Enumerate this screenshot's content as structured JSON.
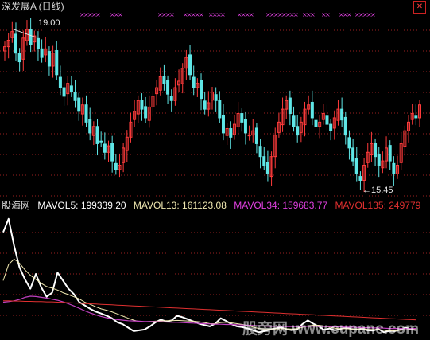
{
  "header": {
    "title": "深发展A (日线)"
  },
  "annotations": {
    "high": "19.00",
    "low": "←15.45"
  },
  "indicator": {
    "name": "股海网",
    "mavol5": "MAVOL5: 199339.20",
    "mavol13": "MAVOL13: 161123.08",
    "mavol34": "MAVOL34: 159683.77",
    "mavol135": "MAVOL135: 249779"
  },
  "watermark": "股旁网 www.cupanc.com",
  "colors": {
    "up": "#ff3b3b",
    "down": "#5fe6e6",
    "marks": "#e040e0",
    "mv5": "#ffffff",
    "mv13": "#f0e8b0",
    "mv34": "#c040c0",
    "mv135": "#e03030",
    "grid": "#9a2020"
  },
  "chart_data": [
    {
      "type": "candlestick",
      "ylim": [
        15.2,
        19.3
      ],
      "markers": {
        "high": 19.0,
        "low": 15.45
      },
      "close": [
        18.55,
        18.7,
        18.9,
        18.4,
        18.2,
        18.75,
        18.95,
        18.6,
        18.8,
        18.5,
        18.3,
        18.5,
        18.1,
        18.4,
        17.9,
        17.6,
        17.4,
        17.7,
        17.5,
        17.3,
        17.05,
        17.2,
        16.8,
        16.55,
        16.7,
        16.3,
        16.35,
        16.1,
        16.25,
        15.9,
        15.7,
        15.8,
        16.2,
        16.45,
        16.8,
        17.05,
        17.3,
        17.1,
        16.9,
        17.15,
        17.4,
        17.6,
        17.85,
        17.7,
        17.45,
        17.3,
        17.6,
        17.75,
        18.05,
        18.3,
        17.9,
        17.6,
        17.7,
        17.35,
        17.1,
        17.25,
        17.5,
        17.3,
        16.9,
        16.55,
        16.65,
        16.45,
        16.75,
        17.0,
        16.8,
        16.55,
        16.5,
        16.6,
        16.3,
        16.0,
        15.8,
        15.6,
        16.0,
        16.5,
        16.8,
        17.1,
        17.3,
        17.0,
        16.7,
        16.5,
        16.8,
        17.1,
        17.2,
        16.9,
        16.7,
        16.8,
        17.0,
        16.75,
        16.6,
        16.9,
        17.1,
        16.85,
        16.5,
        16.2,
        15.9,
        15.6,
        15.45,
        15.8,
        16.1,
        16.3,
        16.0,
        15.8,
        15.9,
        16.2,
        15.9,
        15.6,
        15.8,
        16.3,
        16.6,
        16.8,
        17.0,
        16.9,
        17.2
      ]
    },
    {
      "type": "line",
      "series": [
        {
          "name": "MAVOL5",
          "values": [
            380000,
            430000,
            330000,
            250000,
            205000,
            170000,
            225000,
            175000,
            140000,
            155000,
            230000,
            200000,
            170000,
            150000,
            120000,
            108000,
            95000,
            85000,
            78000,
            70000,
            60000,
            45000,
            38000,
            25000,
            12000,
            15000,
            18000,
            30000,
            45000,
            55000,
            48000,
            52000,
            70000,
            64000,
            56000,
            48000,
            40000,
            35000,
            30000,
            40000,
            60000,
            50000,
            38000,
            30000,
            27000,
            22000,
            15000,
            8000,
            12000,
            18000,
            22000,
            26000,
            20000,
            16000,
            18000,
            38000,
            52000,
            40000,
            30000,
            17000,
            22000,
            15000,
            20000,
            25000,
            20000,
            18000,
            22000,
            15000,
            14000,
            20000,
            8000,
            13000,
            12000,
            18000,
            25000,
            19000,
            16000
          ]
        },
        {
          "name": "MAVOL13",
          "values": [
            200000,
            260000,
            280000,
            265000,
            240000,
            220000,
            205000,
            190000,
            178000,
            172000,
            165000,
            155000,
            148000,
            140000,
            132000,
            120000,
            112000,
            103000,
            95000,
            90000,
            84000,
            76000,
            68000,
            60000,
            53000,
            48000,
            47000,
            48000,
            49000,
            50000,
            51000,
            51000,
            52000,
            51000,
            50000,
            49000,
            47000,
            44000,
            40000,
            40000,
            44000,
            45000,
            43000,
            40000,
            37000,
            33000,
            27000,
            22000,
            20000,
            20000,
            20000,
            21000,
            21000,
            20000,
            21000,
            26000,
            32000,
            34000,
            34000,
            31000,
            27000,
            23000,
            21000,
            21000,
            20000,
            20000,
            21000,
            19000,
            18000,
            18000,
            15000,
            14000,
            13000,
            15000,
            17000,
            17000,
            18000
          ]
        },
        {
          "name": "MAVOL34",
          "values": [
            120000,
            122000,
            125000,
            130000,
            138000,
            142000,
            141000,
            138000,
            135000,
            131000,
            127000,
            121000,
            114000,
            106000,
            97000,
            88000,
            80000,
            73000,
            67000,
            62000,
            58000,
            55000,
            53000,
            51000,
            50000,
            49000,
            48000,
            48000,
            47000,
            47000,
            46000,
            45000,
            45000,
            44000,
            43000,
            42000,
            41000,
            40000,
            39000,
            38000,
            38000,
            37000,
            37000,
            36000,
            35000,
            34000,
            33000,
            32000,
            31000,
            30000,
            30000,
            30000,
            29000,
            29000,
            29000,
            29000,
            30000,
            30000,
            30000,
            29000,
            29000,
            28000,
            28000,
            27000,
            27000,
            26000,
            25000,
            25000,
            24000,
            24000,
            23000,
            22000,
            22000,
            22000,
            22000,
            22000,
            22000
          ]
        },
        {
          "name": "MAVOL135",
          "values": [
            125000,
            125000,
            124000,
            124000,
            123000,
            123000,
            122000,
            122000,
            121000,
            121000,
            120000,
            119000,
            118000,
            117000,
            116000,
            115000,
            114000,
            113000,
            112000,
            111000,
            110000,
            109000,
            108000,
            107000,
            106000,
            105000,
            104000,
            103000,
            102000,
            101000,
            100000,
            99000,
            98000,
            97000,
            96000,
            95000,
            94000,
            93000,
            92000,
            91000,
            90000,
            89000,
            88000,
            87000,
            86000,
            85000,
            84000,
            83000,
            82000,
            81000,
            80000,
            79000,
            78000,
            77000,
            76000,
            75000,
            74000,
            73000,
            72000,
            71000,
            70000,
            69000,
            68000,
            67000,
            66000,
            65000,
            64000,
            63000,
            62000,
            61000,
            60000,
            59000,
            58000,
            57000,
            56000,
            55000,
            54000
          ]
        }
      ],
      "ylim": [
        0,
        450000
      ]
    }
  ]
}
